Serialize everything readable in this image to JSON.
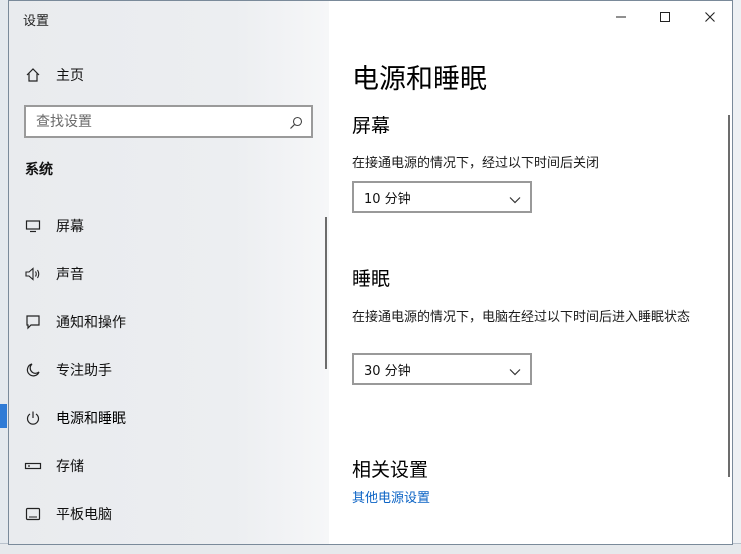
{
  "window": {
    "title": "设置"
  },
  "sidebar": {
    "home_label": "主页",
    "search_placeholder": "查找设置",
    "section_title": "系统",
    "items": [
      {
        "label": "屏幕",
        "icon": "monitor-icon"
      },
      {
        "label": "声音",
        "icon": "speaker-icon"
      },
      {
        "label": "通知和操作",
        "icon": "message-icon"
      },
      {
        "label": "专注助手",
        "icon": "moon-icon"
      },
      {
        "label": "电源和睡眠",
        "icon": "power-icon",
        "active": true
      },
      {
        "label": "存储",
        "icon": "storage-icon"
      },
      {
        "label": "平板电脑",
        "icon": "tablet-icon"
      }
    ]
  },
  "main": {
    "title": "电源和睡眠",
    "screen": {
      "heading": "屏幕",
      "description": "在接通电源的情况下，经过以下时间后关闭",
      "value": "10 分钟"
    },
    "sleep": {
      "heading": "睡眠",
      "description": "在接通电源的情况下，电脑在经过以下时间后进入睡眠状态",
      "value": "30 分钟"
    },
    "related": {
      "heading": "相关设置",
      "link": "其他电源设置"
    }
  },
  "colors": {
    "link": "#0b63c5",
    "sidebar_bg": "#eceef1"
  }
}
